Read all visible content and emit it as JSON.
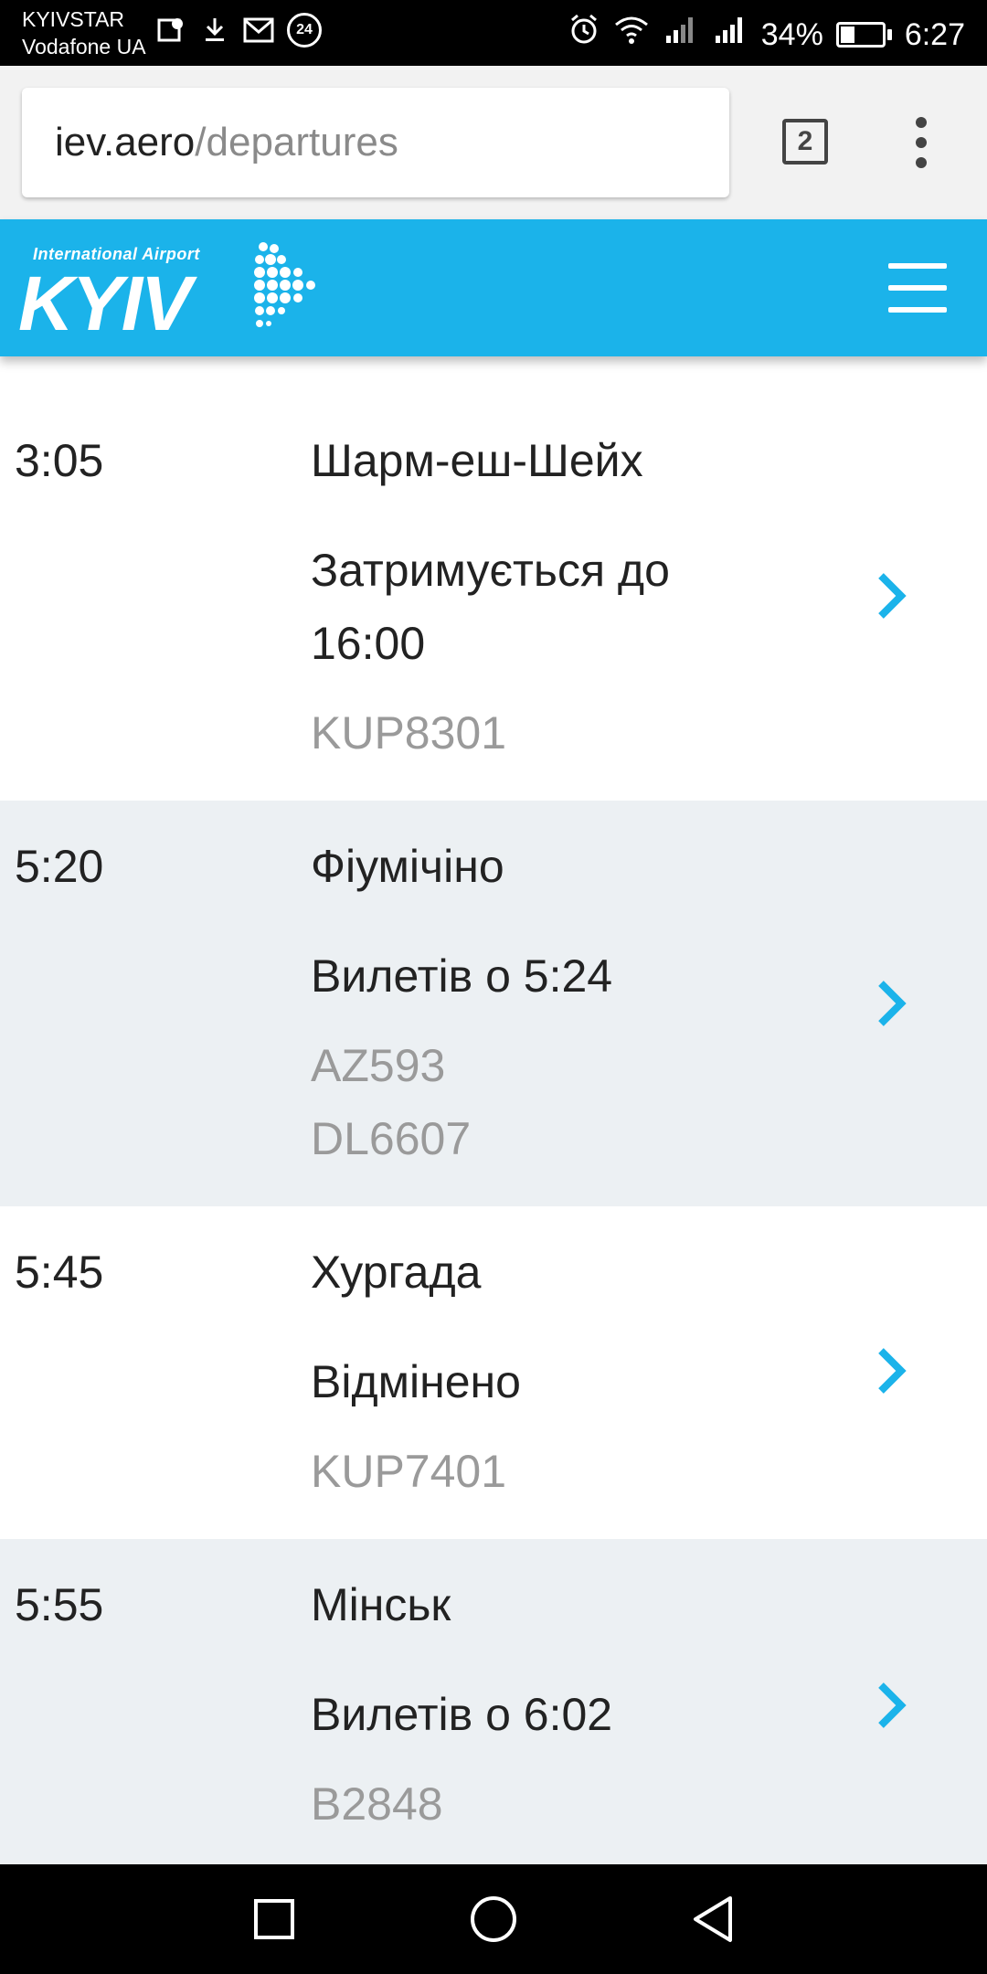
{
  "status_bar": {
    "carrier_1": "KYIVSTAR",
    "carrier_2": "Vodafone UA",
    "notification_count": "24",
    "battery": "34%",
    "battery_level": 0.34,
    "time": "6:27"
  },
  "browser": {
    "url_domain": "iev.aero",
    "url_path": "/departures",
    "tab_count": "2"
  },
  "header": {
    "logo_subtitle": "International Airport",
    "logo_title": "KYIV",
    "accent_color": "#1bb3ea"
  },
  "flights": [
    {
      "time": "3:05",
      "destination": "Шарм-еш-Шейх",
      "status": "Затримується до 16:00",
      "codes": [
        "KUP8301"
      ]
    },
    {
      "time": "5:20",
      "destination": "Фіумічіно",
      "status": "Вилетів о 5:24",
      "codes": [
        "AZ593",
        "DL6607"
      ]
    },
    {
      "time": "5:45",
      "destination": "Хургада",
      "status": "Відмінено",
      "codes": [
        "KUP7401"
      ]
    },
    {
      "time": "5:55",
      "destination": "Мінськ",
      "status": "Вилетів о 6:02",
      "codes": [
        "B2848"
      ]
    }
  ],
  "icons": {
    "chevron": "chevron-right-icon",
    "nav": [
      "recents-icon",
      "home-icon",
      "back-icon"
    ]
  }
}
